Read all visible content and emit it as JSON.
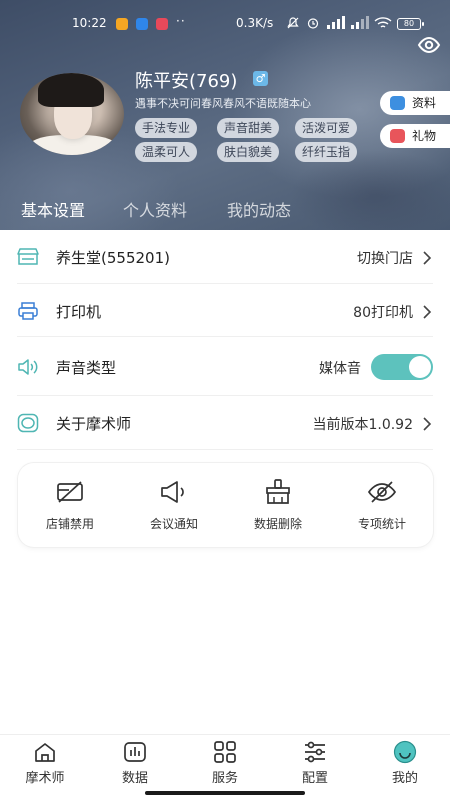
{
  "status_bar": {
    "time": "10:22",
    "dots": "··",
    "net_speed": "0.3K/s",
    "battery": "80"
  },
  "profile": {
    "name": "陈平安(769)",
    "gender_symbol": "♂",
    "signature": "遇事不决可问春风春风不语既随本心",
    "tags": [
      "手法专业",
      "声音甜美",
      "活泼可爱",
      "温柔可人",
      "肤白貌美",
      "纤纤玉指"
    ],
    "side_buttons": {
      "info_label": "资料",
      "gift_label": "礼物"
    }
  },
  "tabs": [
    {
      "label": "基本设置",
      "active": true
    },
    {
      "label": "个人资料",
      "active": false
    },
    {
      "label": "我的动态",
      "active": false
    }
  ],
  "settings": {
    "store": {
      "label": "养生堂(555201)",
      "value": "切换门店",
      "icon": "store-icon"
    },
    "printer": {
      "label": "打印机",
      "value": "80打印机",
      "icon": "printer-icon"
    },
    "sound": {
      "label": "声音类型",
      "value": "媒体音",
      "toggle_on": true,
      "icon": "speaker-icon"
    },
    "about": {
      "label": "关于摩术师",
      "value": "当前版本1.0.92",
      "icon": "about-icon"
    }
  },
  "quick_actions": [
    {
      "label": "店铺禁用",
      "icon": "shop-disable-icon"
    },
    {
      "label": "会议通知",
      "icon": "megaphone-icon"
    },
    {
      "label": "数据删除",
      "icon": "broom-icon"
    },
    {
      "label": "专项统计",
      "icon": "eye-off-icon"
    }
  ],
  "bottom_nav": [
    {
      "label": "摩术师",
      "icon": "home-icon",
      "active": false
    },
    {
      "label": "数据",
      "icon": "chart-icon",
      "active": false
    },
    {
      "label": "服务",
      "icon": "grid-icon",
      "active": false
    },
    {
      "label": "配置",
      "icon": "sliders-icon",
      "active": false
    },
    {
      "label": "我的",
      "icon": "profile-smile-icon",
      "active": true
    }
  ],
  "colors": {
    "accent": "#5dc2bd",
    "header_bg": "#506079",
    "icon_teal": "#4fb6b3"
  }
}
